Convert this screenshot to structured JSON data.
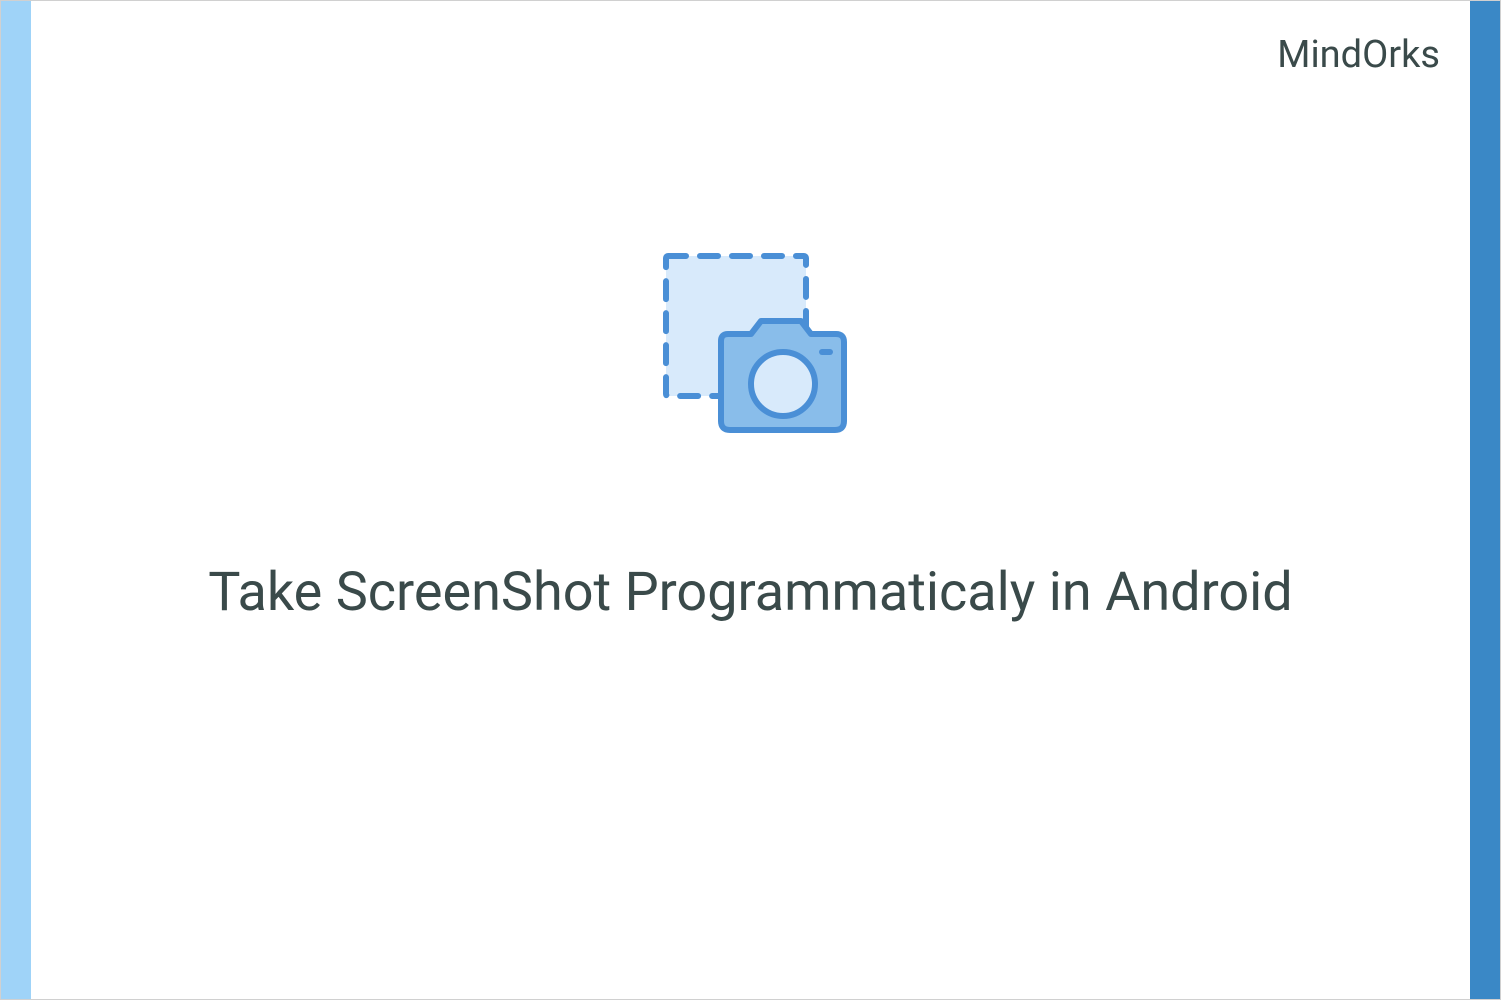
{
  "brand": "MindOrks",
  "title": "Take ScreenShot Programmaticaly in Android",
  "colors": {
    "leftStripe": "#9fd3f8",
    "rightStripe": "#3a88c6",
    "textColor": "#3a4a4a",
    "iconStroke": "#4a8fd6",
    "iconFillLight": "#d8eafb",
    "iconFillMedium": "#89bdea"
  },
  "icon": "screenshot-camera-icon"
}
